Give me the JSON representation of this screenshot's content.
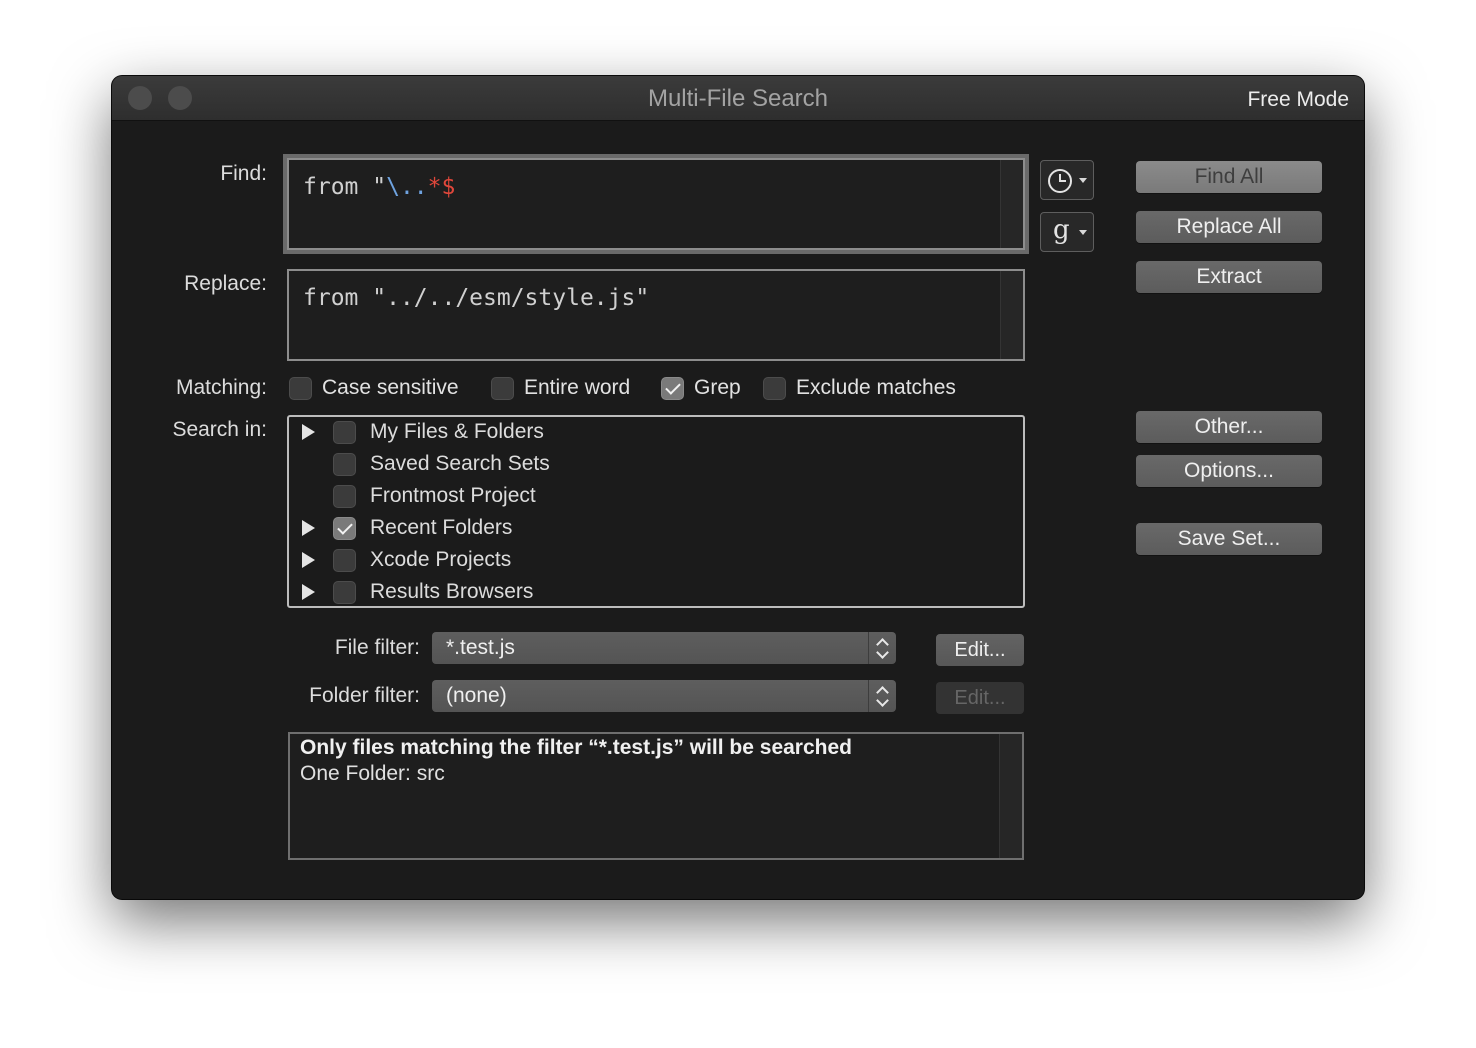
{
  "window": {
    "title": "Multi-File Search",
    "mode": "Free Mode"
  },
  "find": {
    "label": "Find:",
    "value_parts": [
      {
        "text": "from \"",
        "color": "#d0d0d0"
      },
      {
        "text": "\\.",
        "color": "#6fa3e0"
      },
      {
        "text": ".",
        "color": "#6fa3e0"
      },
      {
        "text": "*$",
        "color": "#e0473b"
      }
    ],
    "history_icon": "clock-icon",
    "grep_icon": "g-pattern-icon"
  },
  "replace": {
    "label": "Replace:",
    "value": "from \"../../esm/style.js\""
  },
  "matching": {
    "label": "Matching:",
    "options": [
      {
        "label": "Case sensitive",
        "checked": false
      },
      {
        "label": "Entire word",
        "checked": false
      },
      {
        "label": "Grep",
        "checked": true
      },
      {
        "label": "Exclude matches",
        "checked": false
      }
    ]
  },
  "search_in": {
    "label": "Search in:",
    "items": [
      {
        "label": "My Files & Folders",
        "expandable": true,
        "checked": false
      },
      {
        "label": "Saved Search Sets",
        "expandable": false,
        "checked": false
      },
      {
        "label": "Frontmost Project",
        "expandable": false,
        "checked": false
      },
      {
        "label": "Recent Folders",
        "expandable": true,
        "checked": true
      },
      {
        "label": "Xcode Projects",
        "expandable": true,
        "checked": false
      },
      {
        "label": "Results Browsers",
        "expandable": true,
        "checked": false
      }
    ]
  },
  "file_filter": {
    "label": "File filter:",
    "value": "*.test.js",
    "edit_label": "Edit..."
  },
  "folder_filter": {
    "label": "Folder filter:",
    "value": "(none)",
    "edit_label": "Edit..."
  },
  "status": {
    "line1": "Only files matching the filter “*.test.js” will be searched",
    "line2": "One Folder: src"
  },
  "buttons": {
    "find_all": "Find All",
    "replace_all": "Replace All",
    "extract": "Extract",
    "other": "Other...",
    "options": "Options...",
    "save_set": "Save Set..."
  }
}
